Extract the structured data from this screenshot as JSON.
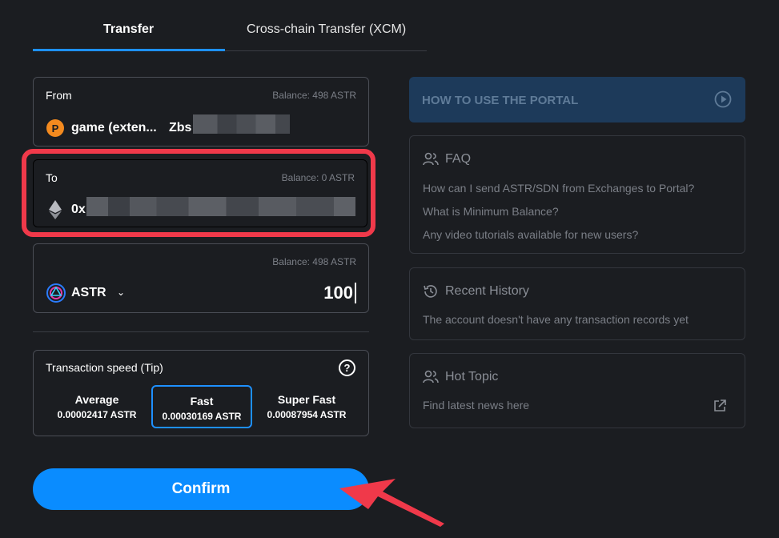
{
  "tabs": {
    "transfer": "Transfer",
    "xcm": "Cross-chain Transfer (XCM)"
  },
  "from": {
    "label": "From",
    "balance": "Balance: 498 ASTR",
    "account_name": "game (exten...",
    "address_prefix": "Zbs"
  },
  "to": {
    "label": "To",
    "balance": "Balance: 0 ASTR",
    "address_prefix": "0x"
  },
  "amount": {
    "balance": "Balance: 498 ASTR",
    "token": "ASTR",
    "value": "100"
  },
  "speed": {
    "title": "Transaction speed (Tip)",
    "help": "?",
    "options": [
      {
        "name": "Average",
        "value": "0.00002417 ASTR"
      },
      {
        "name": "Fast",
        "value": "0.00030169 ASTR",
        "selected": true
      },
      {
        "name": "Super Fast",
        "value": "0.00087954 ASTR"
      }
    ]
  },
  "confirm_label": "Confirm",
  "howto_label": "HOW TO USE THE PORTAL",
  "faq": {
    "title": "FAQ",
    "items": [
      "How can I send ASTR/SDN from Exchanges to Portal?",
      "What is Minimum Balance?",
      "Any video tutorials available for new users?"
    ]
  },
  "recent": {
    "title": "Recent History",
    "text": "The account doesn't have any transaction records yet"
  },
  "hot": {
    "title": "Hot Topic",
    "text": "Find latest news here"
  },
  "colors": {
    "accent": "#0a8cff",
    "highlight": "#f0394a",
    "background": "#1b1d21"
  }
}
